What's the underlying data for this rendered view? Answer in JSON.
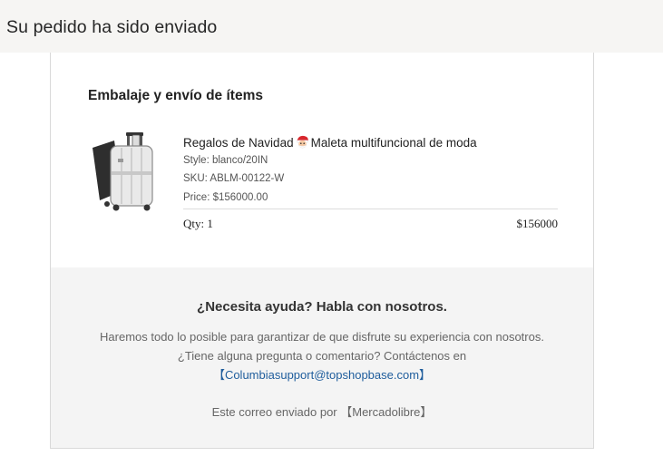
{
  "header": {
    "title": "Su pedido ha sido enviado"
  },
  "items_section": {
    "title": "Embalaje y envío de ítems",
    "item": {
      "name_before": "Regalos de Navidad",
      "name_after": "Maleta multifuncional de moda",
      "emoji_icon": "santa-face-icon",
      "style": "Style: blanco/20IN",
      "sku": "SKU: ABLM-00122-W",
      "price": "Price: $156000.00",
      "qty": "Qty: 1",
      "total": "$156000"
    }
  },
  "help": {
    "title": "¿Necesita ayuda? Habla con nosotros.",
    "body": "Haremos todo lo posible para garantizar de que disfrute su experiencia con nosotros.¿Tiene alguna pregunta o comentario? Contáctenos en",
    "link": "【Columbiasupport@topshopbase.com】",
    "footer": "Este correo enviado por 【Mercadolibre】"
  },
  "colors": {
    "topbar": "#f6f5f3",
    "help_bg": "#f4f4f4",
    "link": "#1f5d9c"
  }
}
